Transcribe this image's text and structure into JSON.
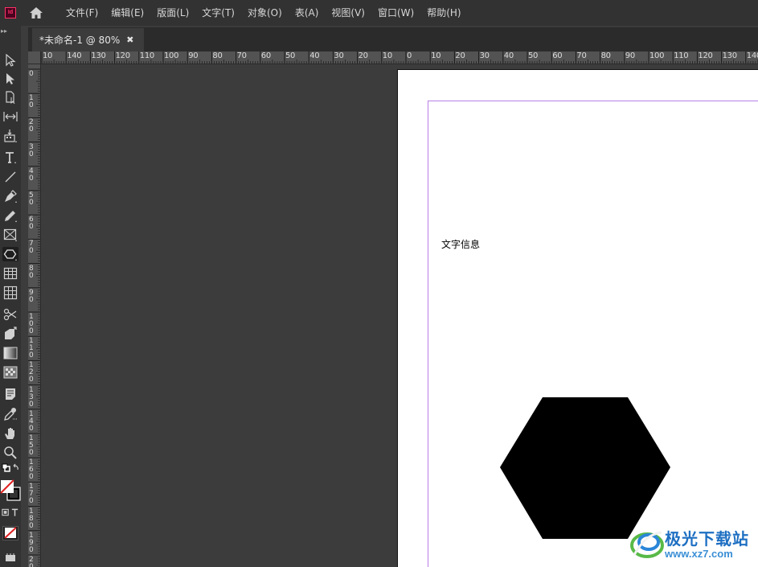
{
  "app": {
    "logo_text": "Id",
    "accent_color": "#ff3366"
  },
  "menubar": {
    "items": [
      "文件(F)",
      "编辑(E)",
      "版面(L)",
      "文字(T)",
      "对象(O)",
      "表(A)",
      "视图(V)",
      "窗口(W)",
      "帮助(H)"
    ]
  },
  "document": {
    "tab_title": "*未命名-1 @ 80%",
    "close_symbol": "✖"
  },
  "rulers": {
    "top_labels": [
      "10",
      "140",
      "130",
      "120",
      "110",
      "100",
      "90",
      "80",
      "70",
      "60",
      "50",
      "40",
      "30",
      "20",
      "10",
      "0",
      "10",
      "20",
      "30",
      "40",
      "50",
      "60",
      "70",
      "80",
      "90",
      "100",
      "110",
      "120",
      "130",
      "140"
    ],
    "left_labels": [
      "0",
      "1 0",
      "2 0",
      "3 0",
      "4 0",
      "5 0",
      "6 0",
      "7 0",
      "8 0",
      "9 0",
      "1 0 0",
      "1 1 0",
      "1 2 0",
      "1 3 0",
      "1 4 0",
      "1 5 0",
      "1 6 0",
      "1 7 0",
      "1 8 0",
      "1 9 0",
      "2 0 0"
    ]
  },
  "canvas": {
    "text_content": "文字信息",
    "shape": "hexagon",
    "shape_fill": "#000000",
    "margin_guide_color": "#b87fe6"
  },
  "watermark": {
    "title": "极光下载站",
    "url": "www.xz7.com"
  },
  "tools": [
    "selection-tool",
    "direct-selection-tool",
    "page-tool",
    "gap-tool",
    "content-collector-tool",
    "type-tool",
    "line-tool",
    "pen-tool",
    "pencil-tool",
    "rectangle-frame-tool",
    "polygon-tool",
    "table-tool",
    "column-tool",
    "scissors-tool",
    "free-transform-tool",
    "gradient-swatch-tool",
    "gradient-feather-tool",
    "note-tool",
    "eyedropper-tool",
    "hand-tool",
    "zoom-tool",
    "fill-stroke-swatches",
    "formatting-container",
    "apply-none",
    "screen-mode"
  ]
}
